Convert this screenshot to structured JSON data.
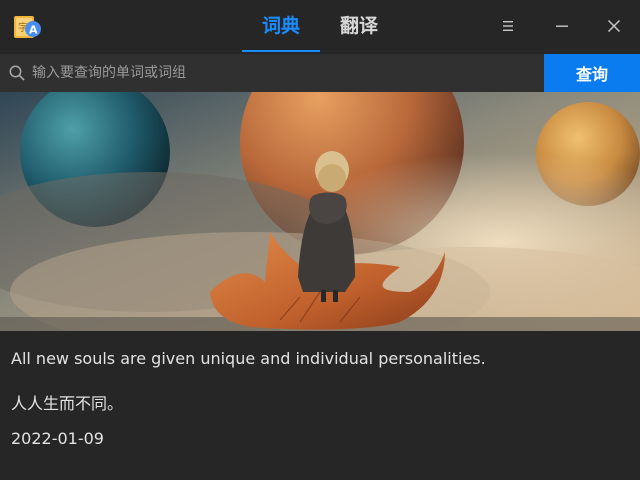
{
  "window": {
    "tabs": [
      {
        "label": "词典",
        "active": true
      },
      {
        "label": "翻译",
        "active": false
      }
    ],
    "icons": {
      "logo": "dictionary-app-logo",
      "menu": "menu-icon",
      "minimize": "minimize-icon",
      "close": "close-icon"
    }
  },
  "search": {
    "placeholder": "输入要查询的单词或词组",
    "value": "",
    "button_label": "查询",
    "icon": "search-icon"
  },
  "daily": {
    "image": "girl-standing-on-autumn-leaf-among-planets",
    "quote_en": "All new souls are given unique and individual personalities.",
    "quote_zh": "人人生而不同。",
    "date": "2022-01-09"
  },
  "colors": {
    "accent": "#1b8cff",
    "button": "#0a7cf0",
    "background": "#262626"
  }
}
